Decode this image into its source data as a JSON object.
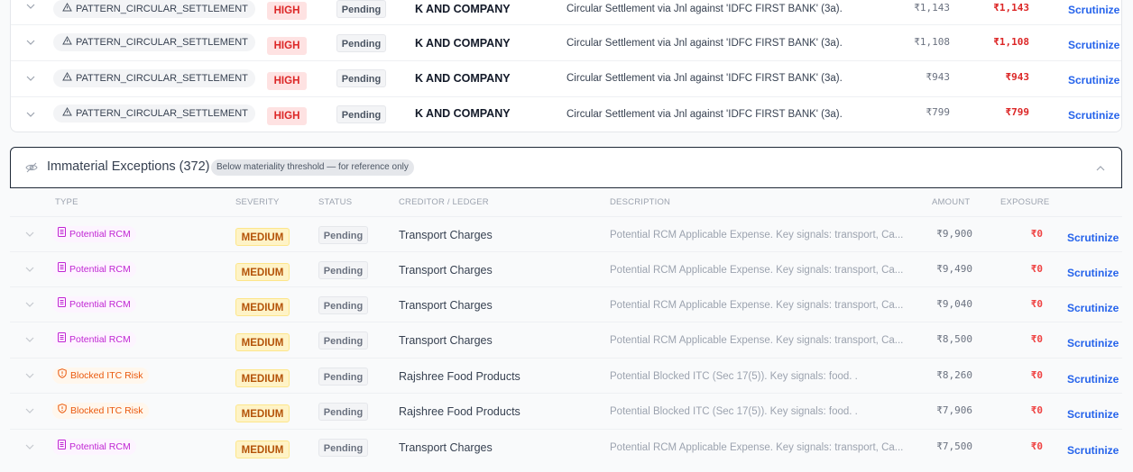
{
  "material": {
    "rows": [
      {
        "type": "PATTERN_CIRCULAR_SETTLEMENT",
        "severity": "HIGH",
        "status": "Pending",
        "creditor": "K AND COMPANY",
        "description": "Circular Settlement via Jnl against 'IDFC FIRST BANK' (3a).",
        "amount": "₹1,143",
        "exposure": "₹1,143",
        "action": "Scrutinize"
      },
      {
        "type": "PATTERN_CIRCULAR_SETTLEMENT",
        "severity": "HIGH",
        "status": "Pending",
        "creditor": "K AND COMPANY",
        "description": "Circular Settlement via Jnl against 'IDFC FIRST BANK' (3a).",
        "amount": "₹1,108",
        "exposure": "₹1,108",
        "action": "Scrutinize"
      },
      {
        "type": "PATTERN_CIRCULAR_SETTLEMENT",
        "severity": "HIGH",
        "status": "Pending",
        "creditor": "K AND COMPANY",
        "description": "Circular Settlement via Jnl against 'IDFC FIRST BANK' (3a).",
        "amount": "₹943",
        "exposure": "₹943",
        "action": "Scrutinize"
      },
      {
        "type": "PATTERN_CIRCULAR_SETTLEMENT",
        "severity": "HIGH",
        "status": "Pending",
        "creditor": "K AND COMPANY",
        "description": "Circular Settlement via Jnl against 'IDFC FIRST BANK' (3a).",
        "amount": "₹799",
        "exposure": "₹799",
        "action": "Scrutinize"
      }
    ]
  },
  "immaterial": {
    "title": "Immaterial Exceptions (372)",
    "note": "Below materiality threshold — for reference only",
    "columns": {
      "type": "TYPE",
      "severity": "SEVERITY",
      "status": "STATUS",
      "creditor": "CREDITOR / LEDGER",
      "description": "DESCRIPTION",
      "amount": "AMOUNT",
      "exposure": "EXPOSURE"
    },
    "rows": [
      {
        "type": "Potential RCM",
        "kind": "rcm",
        "severity": "MEDIUM",
        "status": "Pending",
        "creditor": "Transport Charges",
        "description": "Potential RCM Applicable Expense. Key signals: transport, Ca...",
        "amount": "₹9,900",
        "exposure": "₹0",
        "action": "Scrutinize"
      },
      {
        "type": "Potential RCM",
        "kind": "rcm",
        "severity": "MEDIUM",
        "status": "Pending",
        "creditor": "Transport Charges",
        "description": "Potential RCM Applicable Expense. Key signals: transport, Ca...",
        "amount": "₹9,490",
        "exposure": "₹0",
        "action": "Scrutinize"
      },
      {
        "type": "Potential RCM",
        "kind": "rcm",
        "severity": "MEDIUM",
        "status": "Pending",
        "creditor": "Transport Charges",
        "description": "Potential RCM Applicable Expense. Key signals: transport, Ca...",
        "amount": "₹9,040",
        "exposure": "₹0",
        "action": "Scrutinize"
      },
      {
        "type": "Potential RCM",
        "kind": "rcm",
        "severity": "MEDIUM",
        "status": "Pending",
        "creditor": "Transport Charges",
        "description": "Potential RCM Applicable Expense. Key signals: transport, Ca...",
        "amount": "₹8,500",
        "exposure": "₹0",
        "action": "Scrutinize"
      },
      {
        "type": "Blocked ITC Risk",
        "kind": "itc",
        "severity": "MEDIUM",
        "status": "Pending",
        "creditor": "Rajshree Food Products",
        "description": "Potential Blocked ITC (Sec 17(5)). Key signals: food. .",
        "amount": "₹8,260",
        "exposure": "₹0",
        "action": "Scrutinize"
      },
      {
        "type": "Blocked ITC Risk",
        "kind": "itc",
        "severity": "MEDIUM",
        "status": "Pending",
        "creditor": "Rajshree Food Products",
        "description": "Potential Blocked ITC (Sec 17(5)). Key signals: food. .",
        "amount": "₹7,906",
        "exposure": "₹0",
        "action": "Scrutinize"
      },
      {
        "type": "Potential RCM",
        "kind": "rcm",
        "severity": "MEDIUM",
        "status": "Pending",
        "creditor": "Transport Charges",
        "description": "Potential RCM Applicable Expense. Key signals: transport, Ca...",
        "amount": "₹7,500",
        "exposure": "₹0",
        "action": "Scrutinize"
      }
    ]
  },
  "icons": {
    "expand": "chevron-down-icon",
    "pattern": "warning-triangle-icon",
    "hidden": "eye-off-icon",
    "collapse": "chevron-up-icon",
    "rcm": "document-icon",
    "itc": "shield-alert-icon"
  }
}
